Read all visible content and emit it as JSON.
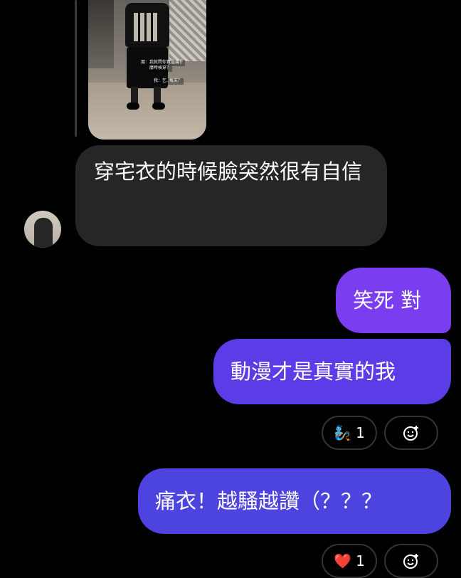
{
  "shared_image": {
    "captions": [
      "朋：我就問你買這幾什",
      "麼時候穿？",
      "我：乞..每天？"
    ]
  },
  "incoming": {
    "message": "穿宅衣的時候臉突然很有自信"
  },
  "outgoing": [
    {
      "message": "笑死 對"
    },
    {
      "message": "動漫才是真實的我"
    },
    {
      "message": "痛衣！越騷越讚（？？？"
    }
  ],
  "reactions": [
    {
      "emoji": "🧞",
      "count": "1"
    },
    {
      "emoji": "❤️",
      "count": "1"
    }
  ],
  "icons": {
    "add_reaction": "smiley-plus-icon",
    "avatar": "avatar"
  },
  "colors": {
    "background": "#000000",
    "incoming_bubble": "#262626",
    "outgoing_top": "#7a3df0",
    "outgoing_mid": "#5c3ce6",
    "outgoing_bottom": "#4d44e0"
  }
}
